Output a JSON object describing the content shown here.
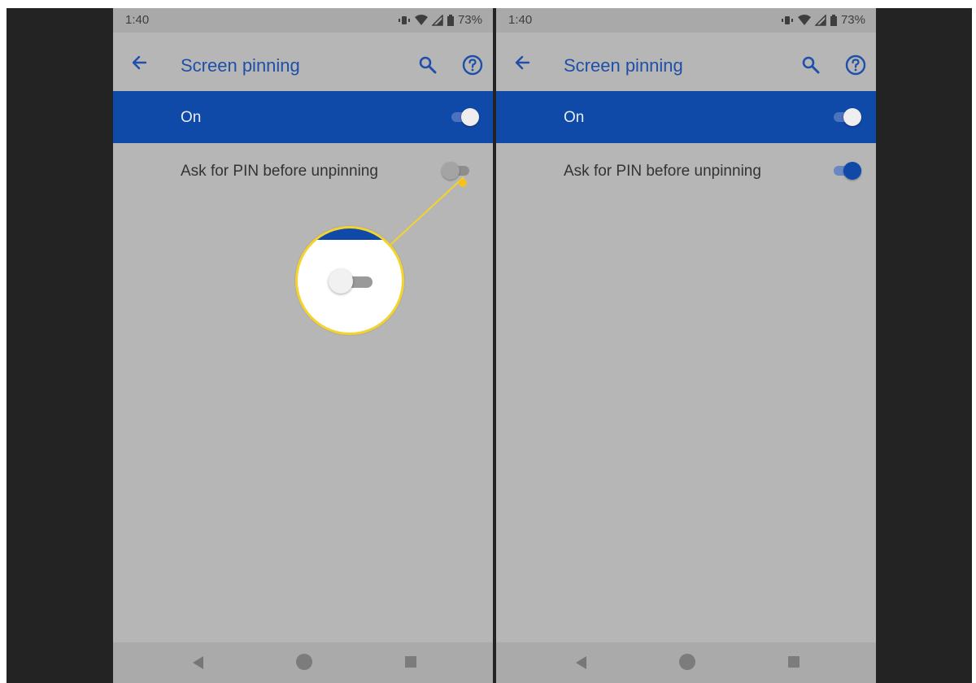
{
  "colors": {
    "accent": "#0f4aa8",
    "title": "#1f4fa8",
    "callout": "#f4d32a",
    "background": "#b6b6b6",
    "frame": "#232323"
  },
  "left_screen": {
    "status": {
      "time": "1:40",
      "battery": "73%"
    },
    "appbar": {
      "title": "Screen pinning"
    },
    "main_switch": {
      "label": "On",
      "state": "on"
    },
    "pin_switch": {
      "label": "Ask for PIN before unpinning",
      "state": "off"
    },
    "callout": {
      "shows": "pin_switch",
      "state": "off"
    }
  },
  "right_screen": {
    "status": {
      "time": "1:40",
      "battery": "73%"
    },
    "appbar": {
      "title": "Screen pinning"
    },
    "main_switch": {
      "label": "On",
      "state": "on"
    },
    "pin_switch": {
      "label": "Ask for PIN before unpinning",
      "state": "on"
    }
  }
}
